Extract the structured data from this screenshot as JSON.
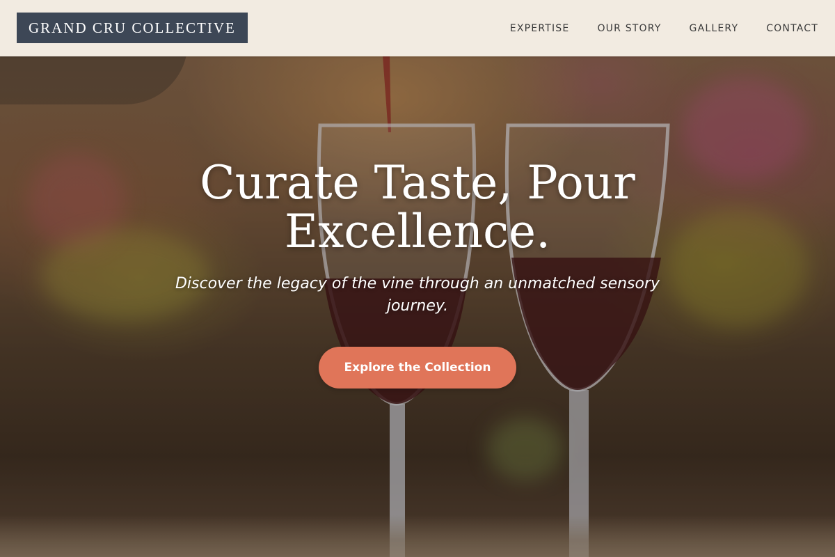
{
  "brand": {
    "name": "GRAND CRU COLLECTIVE"
  },
  "nav": {
    "items": [
      {
        "label": "EXPERTISE"
      },
      {
        "label": "OUR STORY"
      },
      {
        "label": "GALLERY"
      },
      {
        "label": "CONTACT"
      }
    ]
  },
  "hero": {
    "title_line1": "Curate Taste, Pour",
    "title_line2": "Excellence.",
    "subtitle": "Discover the legacy of the vine through an unmatched sensory journey.",
    "cta_label": "Explore the Collection",
    "background_description_icon": "wine-glasses-photo"
  },
  "colors": {
    "nav_background": "#f2ebe1",
    "brand_background": "#3d4756",
    "cta_background": "#e07559",
    "text_light": "#ffffff"
  }
}
